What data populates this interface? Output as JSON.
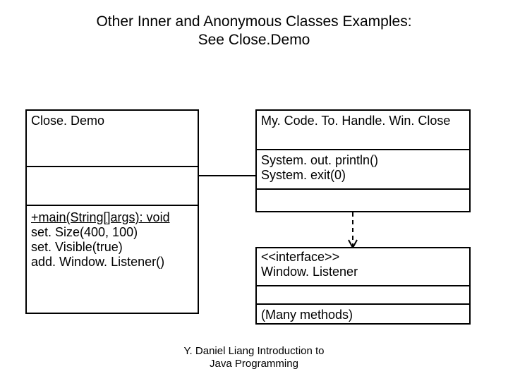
{
  "title_line1": "Other Inner and Anonymous Classes Examples:",
  "title_line2": "See Close.Demo",
  "close_demo": {
    "name": "Close. Demo",
    "method_main": "+main(String[]args): void",
    "method_setSize": "set. Size(400, 100)",
    "method_setVisible": "set. Visible(true)",
    "method_addListener": "add. Window. Listener()"
  },
  "handler": {
    "name": "My. Code. To. Handle. Win. Close",
    "line_println": "System. out. println()",
    "line_exit": "System. exit(0)"
  },
  "interface": {
    "stereotype": "<<interface>>",
    "name": "Window. Listener",
    "methods": "(Many methods)"
  },
  "footer_line1": "Y. Daniel Liang Introduction to",
  "footer_line2": "Java Programming",
  "chart_data": {
    "type": "table",
    "description": "UML-style class diagram with three boxes and two connectors",
    "boxes": [
      {
        "id": "CloseDemo",
        "compartments": [
          [
            "Close. Demo"
          ],
          [],
          [
            "+main(String[]args): void",
            "set. Size(400, 100)",
            "set. Visible(true)",
            "add. Window. Listener()"
          ]
        ]
      },
      {
        "id": "MyCodeToHandleWinClose",
        "compartments": [
          [
            "My. Code. To. Handle. Win. Close"
          ],
          [
            "System. out. println()",
            "System. exit(0)"
          ],
          []
        ]
      },
      {
        "id": "WindowListener",
        "compartments": [
          [
            "<<interface>>",
            "Window. Listener"
          ],
          [],
          [
            "(Many methods)"
          ]
        ]
      }
    ],
    "connectors": [
      {
        "from": "CloseDemo",
        "to": "MyCodeToHandleWinClose",
        "style": "solid",
        "arrow": false
      },
      {
        "from": "MyCodeToHandleWinClose",
        "to": "WindowListener",
        "style": "dashed",
        "arrow": true
      }
    ]
  }
}
